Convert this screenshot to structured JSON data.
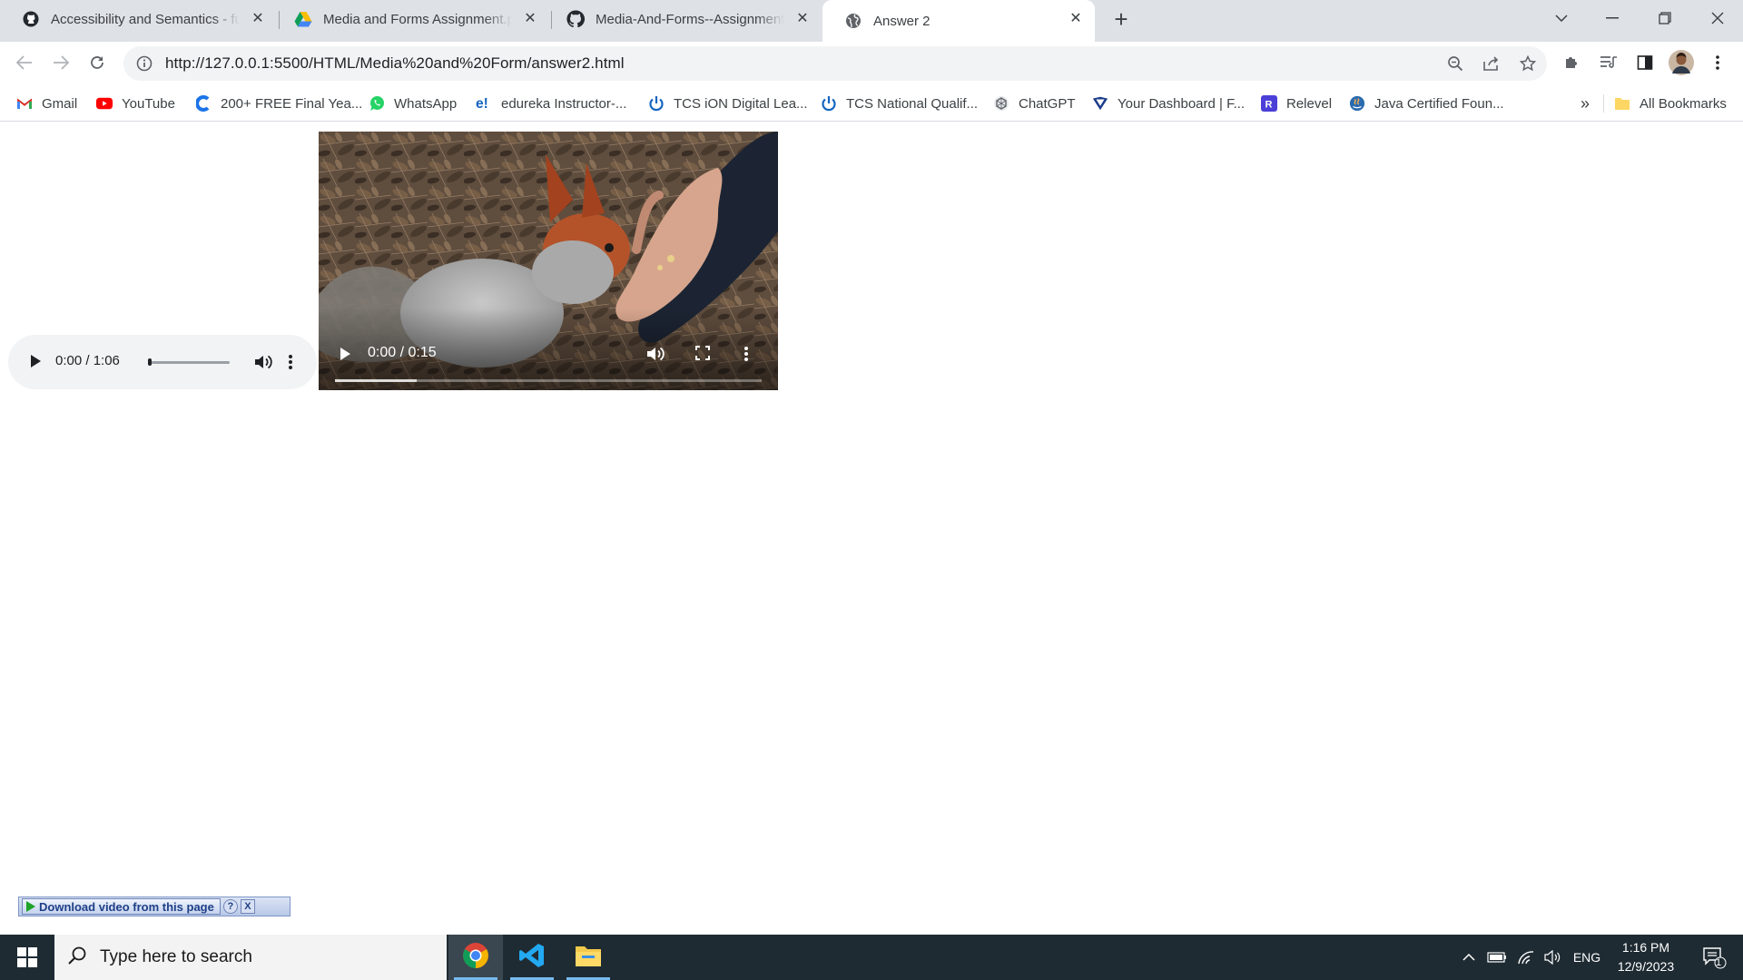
{
  "browser": {
    "tabs": [
      {
        "title": "Accessibility and Semantics - full",
        "icon": "github-icon",
        "active": false
      },
      {
        "title": "Media and Forms Assignment.pdf",
        "icon": "google-drive-icon",
        "active": false
      },
      {
        "title": "Media-And-Forms--Assignment",
        "icon": "github-icon",
        "active": false
      },
      {
        "title": "Answer 2",
        "icon": "globe-icon",
        "active": true
      }
    ],
    "url": "http://127.0.0.1:5500/HTML/Media%20and%20Form/answer2.html",
    "bookmarks": [
      {
        "label": "Gmail",
        "icon": "gmail-icon",
        "color": "#ea4335"
      },
      {
        "label": "YouTube",
        "icon": "youtube-icon",
        "color": "#ff0000"
      },
      {
        "label": "200+ FREE Final Yea...",
        "icon": "c-logo-icon",
        "color": "#1a73e8"
      },
      {
        "label": "WhatsApp",
        "icon": "whatsapp-icon",
        "color": "#25d366"
      },
      {
        "label": "edureka Instructor-...",
        "icon": "edureka-icon",
        "color": "#1565c0"
      },
      {
        "label": "TCS iON Digital Lea...",
        "icon": "power-icon",
        "color": "#1565c0"
      },
      {
        "label": "TCS National Qualif...",
        "icon": "power-icon",
        "color": "#1565c0"
      },
      {
        "label": "ChatGPT",
        "icon": "chatgpt-icon",
        "color": "#5f6368"
      },
      {
        "label": "Your Dashboard | F...",
        "icon": "dashboard-icon",
        "color": "#1a3c8a"
      },
      {
        "label": "Relevel",
        "icon": "relevel-icon",
        "color": "#4b3fd8"
      },
      {
        "label": "Java Certified Foun...",
        "icon": "java-icon",
        "color": "#2b6cb0"
      }
    ],
    "overflow_label": "»",
    "all_bookmarks_label": "All Bookmarks"
  },
  "page": {
    "audio": {
      "time": "0:00 / 1:06"
    },
    "video": {
      "time": "0:00 / 0:15"
    },
    "download_bar": {
      "label": "Download video from this page",
      "help": "?",
      "close": "X"
    }
  },
  "taskbar": {
    "search_placeholder": "Type here to search",
    "language": "ENG",
    "time": "1:16 PM",
    "date": "12/9/2023",
    "notification_count": "1"
  }
}
